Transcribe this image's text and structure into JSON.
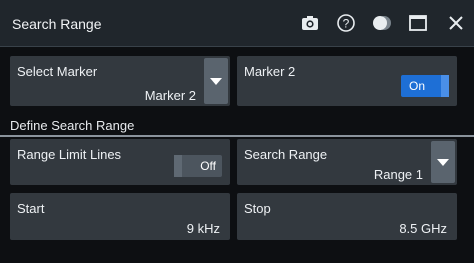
{
  "dialog": {
    "title": "Search Range",
    "icons": [
      "camera-icon",
      "help-icon",
      "theme-toggle-icon",
      "maximize-icon",
      "close-icon"
    ]
  },
  "select_marker": {
    "label": "Select Marker",
    "value": "Marker 2"
  },
  "marker_toggle": {
    "label": "Marker 2",
    "state": "On"
  },
  "section": {
    "title": "Define Search Range"
  },
  "range_limit_lines": {
    "label": "Range Limit Lines",
    "state": "Off"
  },
  "search_range": {
    "label": "Search Range",
    "value": "Range 1"
  },
  "start": {
    "label": "Start",
    "value": "9 kHz"
  },
  "stop": {
    "label": "Stop",
    "value": "8.5 GHz"
  },
  "colors": {
    "accent_on": "#1e6fd6",
    "field_bg": "#33393f",
    "titlebar_bg": "#20262c"
  }
}
